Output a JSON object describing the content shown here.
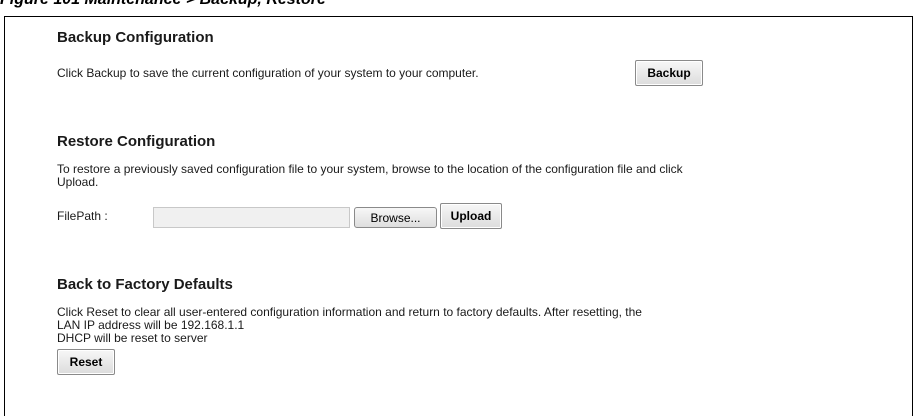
{
  "caption": "Figure 101   Maintenance > Backup, Restore",
  "backup": {
    "title": "Backup Configuration",
    "description": "Click Backup to save the current configuration of your system to your computer.",
    "button_label": "Backup"
  },
  "restore": {
    "title": "Restore Configuration",
    "description_line1": "To restore a previously saved configuration file to your system, browse to the location of the configuration file and click",
    "description_line2": "Upload.",
    "filepath_label": "FilePath :",
    "filepath_value": "",
    "browse_label": "Browse...",
    "upload_label": "Upload"
  },
  "factory": {
    "title": "Back to Factory Defaults",
    "line1": "Click Reset to clear all user-entered configuration information and return to factory defaults. After resetting, the",
    "line2": "LAN IP address will be 192.168.1.1",
    "line3": "DHCP will be reset to server",
    "reset_label": "Reset"
  }
}
